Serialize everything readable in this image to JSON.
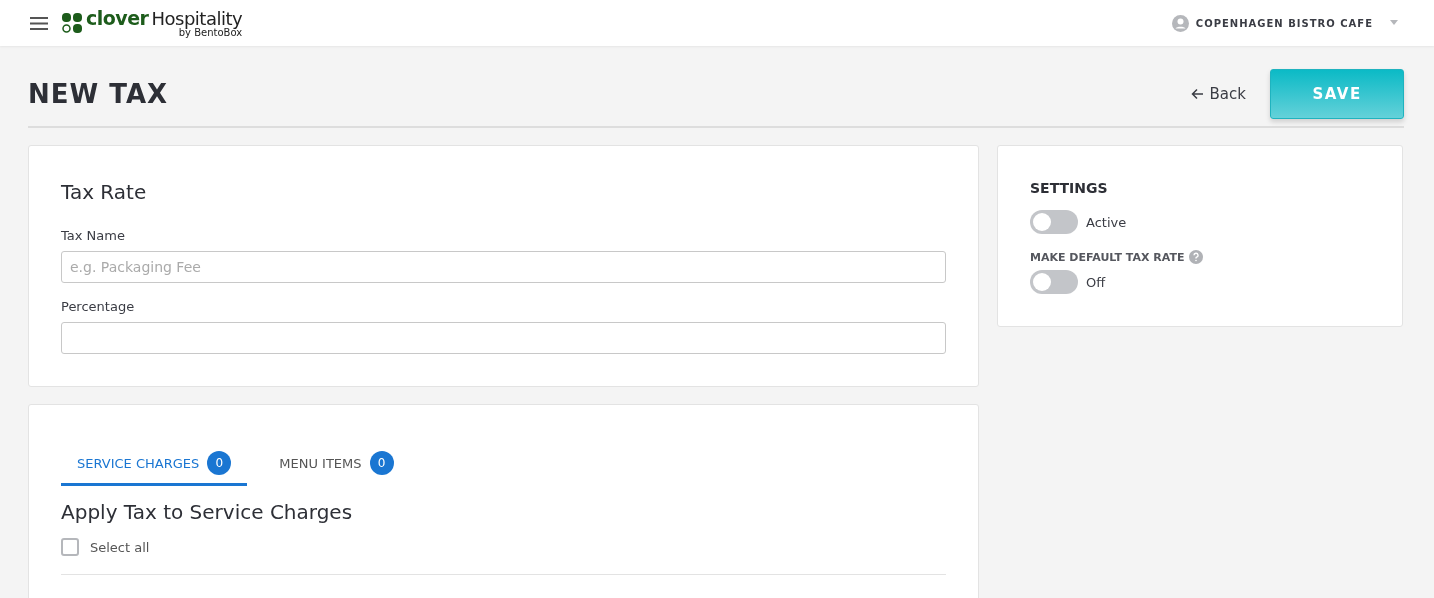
{
  "header": {
    "logo": {
      "brand": "clover",
      "product": "Hospitality",
      "byline": "by BentoBox"
    },
    "account": "COPENHAGEN BISTRO CAFE"
  },
  "page": {
    "title": "NEW TAX",
    "back": "Back",
    "save": "SAVE"
  },
  "tax_rate": {
    "title": "Tax Rate",
    "fields": [
      {
        "label": "Tax Name",
        "placeholder": "e.g. Packaging Fee"
      },
      {
        "label": "Percentage"
      }
    ]
  },
  "settings": {
    "title": "SETTINGS",
    "toggles": [
      {
        "label": "Active",
        "on": false
      },
      {
        "heading": "MAKE DEFAULT TAX RATE",
        "label": "Off",
        "on": false
      }
    ]
  },
  "apply": {
    "tabs": [
      {
        "label": "SERVICE CHARGES",
        "count": "0",
        "selected": true
      },
      {
        "label": "MENU ITEMS",
        "count": "0",
        "selected": false
      }
    ],
    "title": "Apply Tax to Service Charges",
    "select_all": {
      "label": "Select all",
      "checked": false
    }
  }
}
